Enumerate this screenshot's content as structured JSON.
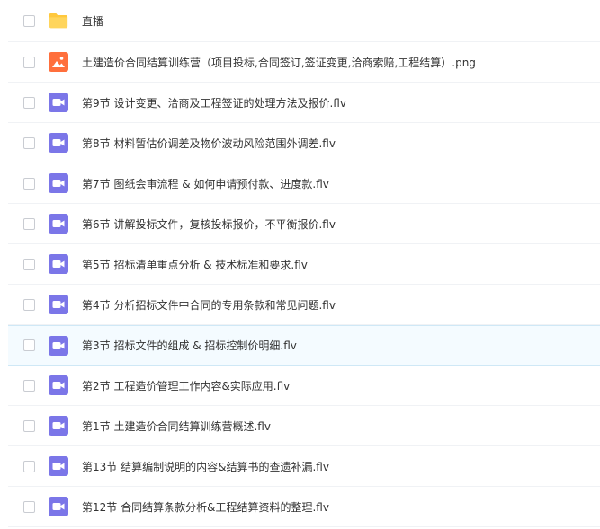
{
  "files": [
    {
      "name": "直播",
      "icon": "folder-icon"
    },
    {
      "name": "土建造价合同结算训练营（项目投标,合同签订,签证变更,洽商索赔,工程结算）.png",
      "icon": "image-file-icon"
    },
    {
      "name": "第9节 设计变更、洽商及工程签证的处理方法及报价.flv",
      "icon": "video-file-icon"
    },
    {
      "name": "第8节 材料暂估价调差及物价波动风险范围外调差.flv",
      "icon": "video-file-icon"
    },
    {
      "name": "第7节 图纸会审流程 & 如何申请预付款、进度款.flv",
      "icon": "video-file-icon"
    },
    {
      "name": "第6节 讲解投标文件，复核投标报价，不平衡报价.flv",
      "icon": "video-file-icon"
    },
    {
      "name": "第5节 招标清单重点分析 & 技术标准和要求.flv",
      "icon": "video-file-icon"
    },
    {
      "name": "第4节 分析招标文件中合同的专用条款和常见问题.flv",
      "icon": "video-file-icon"
    },
    {
      "name": "第3节 招标文件的组成 & 招标控制价明细.flv",
      "icon": "video-file-icon"
    },
    {
      "name": "第2节 工程造价管理工作内容&实际应用.flv",
      "icon": "video-file-icon"
    },
    {
      "name": "第1节 土建造价合同结算训练营概述.flv",
      "icon": "video-file-icon"
    },
    {
      "name": "第13节 结算编制说明的内容&结算书的查遗补漏.flv",
      "icon": "video-file-icon"
    },
    {
      "name": "第12节 合同结算条款分析&工程结算资料的整理.flv",
      "icon": "video-file-icon"
    }
  ],
  "colors": {
    "folder": "#ffc83d",
    "image_file": "#ff6f3c",
    "video_file": "#7b76e8",
    "row_highlight": "#f4fbff"
  }
}
